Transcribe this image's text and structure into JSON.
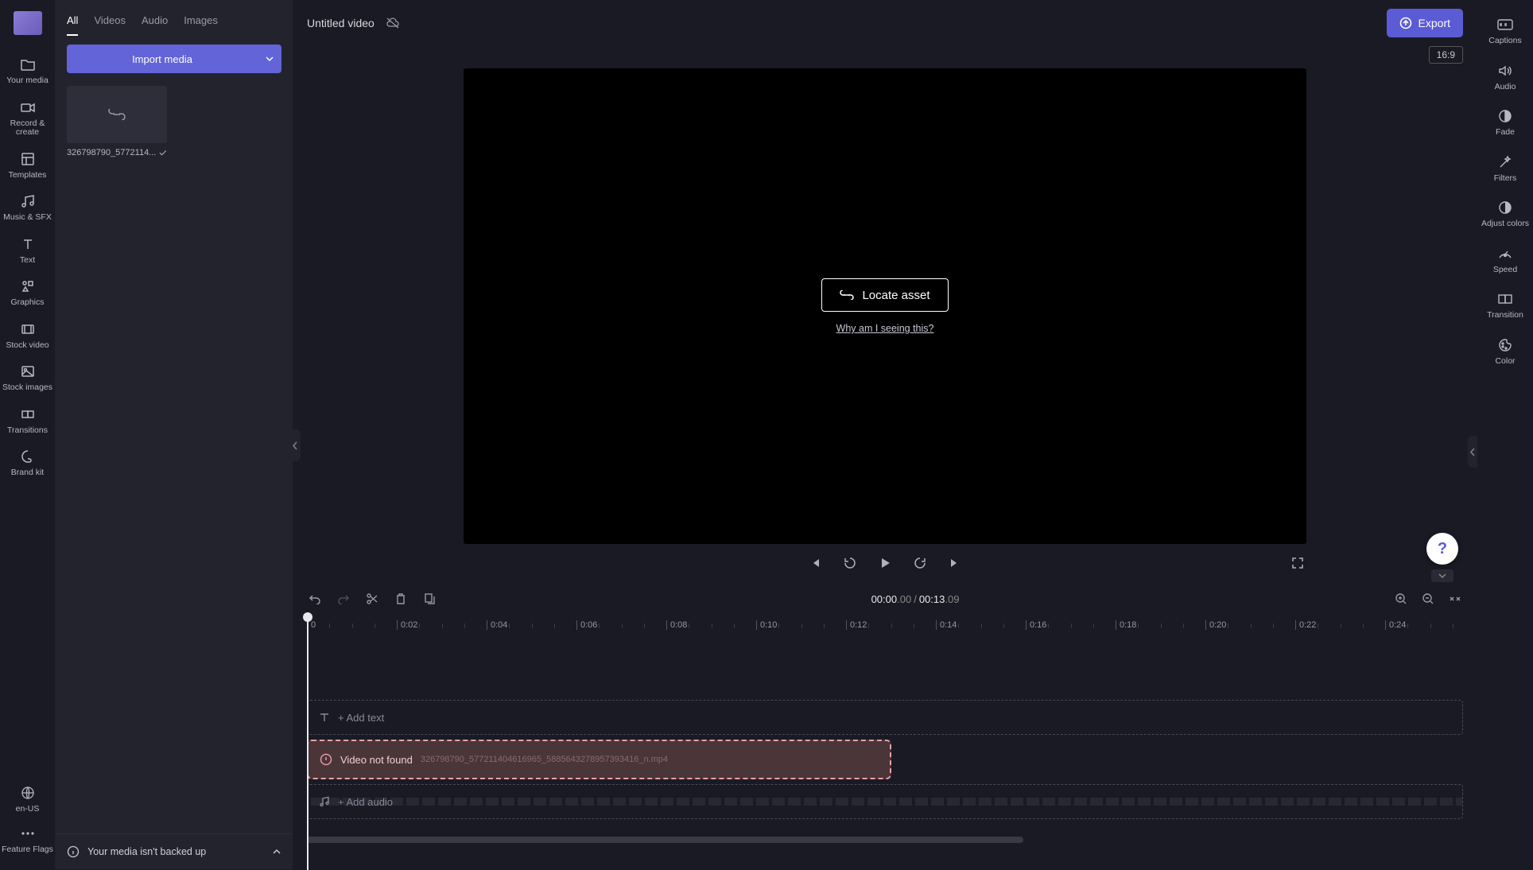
{
  "topbar": {
    "title": "Untitled video",
    "export_label": "Export",
    "aspect": "16:9"
  },
  "left_rail": {
    "items": [
      {
        "label": "Your media"
      },
      {
        "label": "Record & create"
      },
      {
        "label": "Templates"
      },
      {
        "label": "Music & SFX"
      },
      {
        "label": "Text"
      },
      {
        "label": "Graphics"
      },
      {
        "label": "Stock video"
      },
      {
        "label": "Stock images"
      },
      {
        "label": "Transitions"
      },
      {
        "label": "Brand kit"
      }
    ],
    "bottom": [
      {
        "label": "en-US"
      },
      {
        "label": "Feature Flags"
      }
    ]
  },
  "media_panel": {
    "tabs": [
      "All",
      "Videos",
      "Audio",
      "Images"
    ],
    "active_tab": 0,
    "import_label": "Import media",
    "item": {
      "name": "326798790_5772114..."
    },
    "backup_msg": "Your media isn't backed up"
  },
  "preview": {
    "locate_label": "Locate asset",
    "why_label": "Why am I seeing this?"
  },
  "right_rail": {
    "items": [
      {
        "label": "Captions"
      },
      {
        "label": "Audio"
      },
      {
        "label": "Fade"
      },
      {
        "label": "Filters"
      },
      {
        "label": "Adjust colors"
      },
      {
        "label": "Speed"
      },
      {
        "label": "Transition"
      },
      {
        "label": "Color"
      }
    ]
  },
  "timeline": {
    "time_current": "00:00",
    "time_current_frac": ".00",
    "time_duration": "00:13",
    "time_duration_frac": ".09",
    "ruler_ticks": [
      "0",
      "0:02",
      "0:04",
      "0:06",
      "0:08",
      "0:10",
      "0:12",
      "0:14",
      "0:16",
      "0:18",
      "0:20",
      "0:22",
      "0:24"
    ],
    "text_track_label": "+ Add text",
    "audio_track_label": "+ Add audio",
    "clip": {
      "title": "Video not found",
      "filename": "326798790_577211404616965_5885643278957393416_n.mp4"
    }
  }
}
